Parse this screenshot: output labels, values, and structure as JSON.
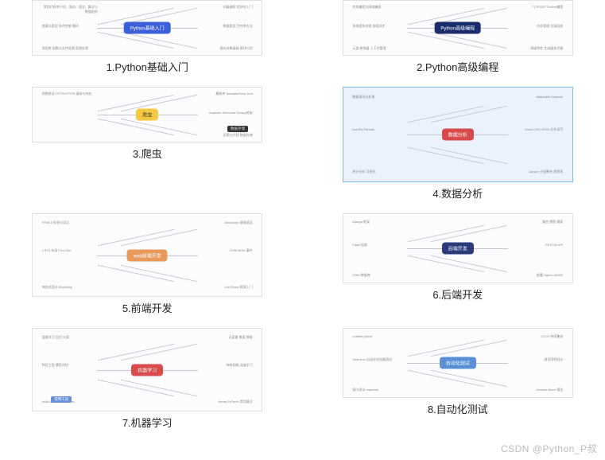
{
  "watermark": "CSDN @Python_P叔",
  "thumbnails": [
    {
      "caption": "1.Python基础入门",
      "center": "Python基础入门",
      "center_class": "node-blue",
      "size": "h-sm",
      "highlight": false,
      "branches": {
        "tl": "常用代码库介绍、面向、语法、算法与数据结构",
        "ml": "变量与类型\n条件控制\n循环",
        "bl": "常用库 函数与文件处理 异常处理",
        "tr": "初级编程\n程序化入门",
        "mr": "数据类型\n字符串方法",
        "br": "面向对象基础\n模块与包"
      }
    },
    {
      "caption": "2.Python高级编程",
      "center": "Python高级编程",
      "center_class": "node-darkblue",
      "size": "h-sm",
      "highlight": false,
      "branches": {
        "tl": "并发编程与网络编程",
        "ml": "多线程多进程\n协程异步",
        "bl": "元类 装饰器 上下文管理",
        "tr": "TCP/UDP\nSocket编程",
        "mr": "内存管理\n垃圾回收",
        "br": "高级特性\n生成器迭代器"
      }
    },
    {
      "caption": "3.爬虫",
      "center": "爬虫",
      "center_class": "node-yellow",
      "size": "h-sm",
      "highlight": false,
      "branches": {
        "tl": "网络协议 HTTP/HTTPS 请求与响应",
        "ml": "",
        "bl": "",
        "tr": "解析库 BeautifulSoup lxml",
        "mr": "requests\nSelenium\nScrapy框架",
        "br": "反爬与代理\n数据存储   "
      },
      "extras": [
        {
          "text": "数据存储",
          "class": "sub-dark",
          "style": "right:6%;bottom:18%;"
        }
      ]
    },
    {
      "caption": "4.数据分析",
      "center": "数据分析",
      "center_class": "node-red",
      "size": "h-lg",
      "highlight": true,
      "branches": {
        "tl": "数据清洗与处理",
        "ml": "NumPy\nPandas",
        "bl": "统计分析 可视化",
        "tr": "Matplotlib\nSeaborn",
        "mr": "Excel CSV JSON 文件读写",
        "br": "Jupyter\n分组聚合\n透视表"
      }
    },
    {
      "caption": "5.前端开发",
      "center": "web前端开发",
      "center_class": "node-orange",
      "size": "h-md",
      "highlight": false,
      "branches": {
        "tl": "HTML5 标签与语义",
        "ml": "CSS3 布局\nFlex Grid",
        "bl": "响应式设计 Bootstrap",
        "tr": "JavaScript 基础语法",
        "mr": "DOM BOM\n事件",
        "br": "Vue React 框架入门"
      }
    },
    {
      "caption": "6.后端开发",
      "center": "后端开发",
      "center_class": "node-navy",
      "size": "h-xl",
      "highlight": false,
      "branches": {
        "tl": "Django 框架",
        "ml": "Flask 轻量",
        "bl": "ORM 数据库",
        "tr": "路由 视图 模板",
        "mr": "RESTful API",
        "br": "部署 Nginx uWSGI"
      }
    },
    {
      "caption": "7.机器学习",
      "center": "机器学习",
      "center_class": "node-red",
      "size": "h-md",
      "highlight": false,
      "branches": {
        "tl": "监督学习 回归 分类",
        "ml": "特征工程\n模型评估",
        "bl": "scikit-learn TensorFlow",
        "tr": "无监督 聚类 降维",
        "mr": "神经网络\n深度学习",
        "br": "Keras PyTorch 常用算法"
      },
      "extras": [
        {
          "text": "常用工具",
          "class": "sub-blue",
          "style": "left:8%;bottom:10%;"
        }
      ]
    },
    {
      "caption": "8.自动化测试",
      "center": "自动化测试",
      "center_class": "node-skyblue",
      "size": "h-xl",
      "highlight": false,
      "branches": {
        "tl": "unittest pytest",
        "ml": "Selenium 自动化浏览器测试",
        "bl": "接口测试 requests",
        "tr": "CI/CD 持续集成",
        "mr": "测试用例设计",
        "br": "Jenkins\nAllure 报告"
      }
    }
  ]
}
